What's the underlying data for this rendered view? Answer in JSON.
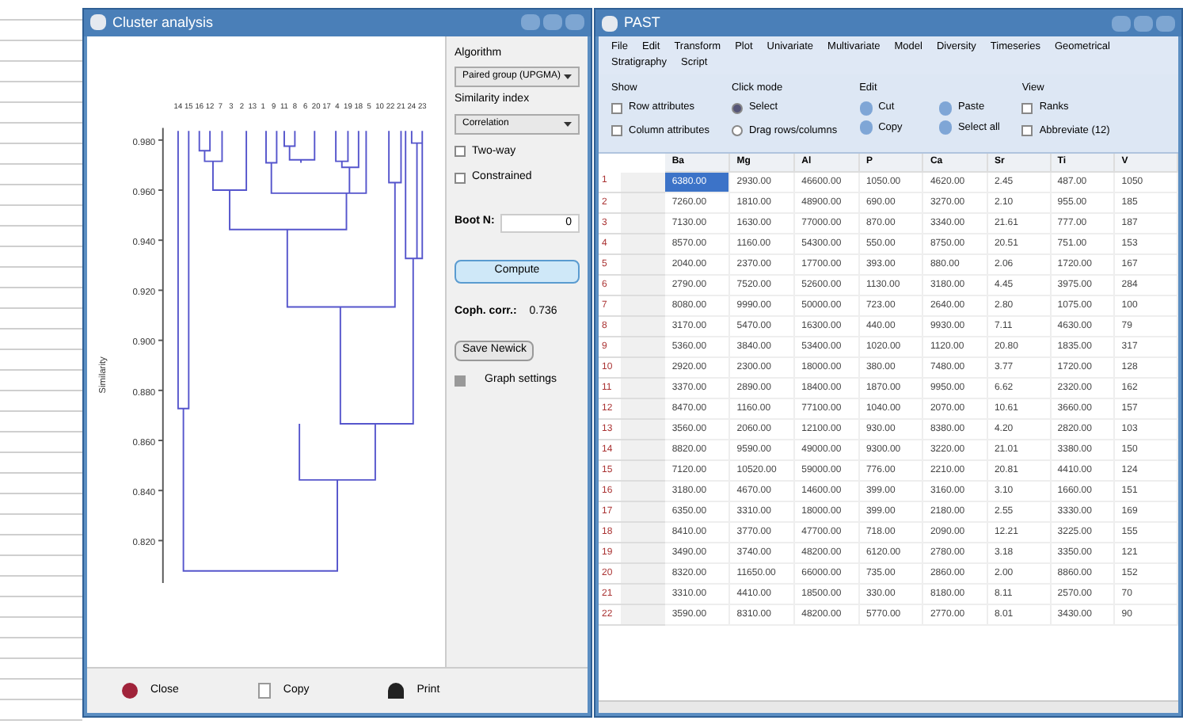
{
  "cluster_window": {
    "title": "Cluster analysis",
    "axis_title": "Similarity",
    "y_ticks": [
      "0.980",
      "0.960",
      "0.940",
      "0.920",
      "0.900",
      "0.880",
      "0.860",
      "0.840",
      "0.820"
    ],
    "leaf_labels": [
      "14",
      "15",
      "16",
      "12",
      "7",
      "3",
      "2",
      "13",
      "1",
      "9",
      "11",
      "8",
      "6",
      "20",
      "17",
      "4",
      "19",
      "18",
      "5",
      "10",
      "22",
      "21",
      "24",
      "23"
    ],
    "algorithm": {
      "label": "Algorithm",
      "value": "Paired group (UPGMA)"
    },
    "similarity": {
      "label": "Similarity index",
      "value": "Correlation"
    },
    "options": [
      {
        "label": "Two-way",
        "checked": false
      },
      {
        "label": "Constrained",
        "checked": false
      }
    ],
    "boot": {
      "label": "Boot N:",
      "value": "0"
    },
    "compute": "Compute",
    "coph": {
      "label": "Coph. corr.:",
      "value": "0.736"
    },
    "save_button": "Save Newick",
    "graph_settings": "Graph settings",
    "bottom_buttons": [
      "Close",
      "Copy",
      "Print"
    ]
  },
  "past_window": {
    "title": "PAST",
    "menu": [
      "File",
      "Edit",
      "Transform",
      "Plot",
      "Univariate",
      "Multivariate",
      "Model",
      "Diversity",
      "Timeseries",
      "Geometrical",
      "Stratigraphy",
      "Script"
    ],
    "groups": [
      {
        "title": "Show",
        "items": [
          {
            "kind": "check",
            "label": "Row attributes",
            "checked": false
          },
          {
            "kind": "check",
            "label": "Column attributes",
            "checked": false
          }
        ]
      },
      {
        "title": "Click mode",
        "items": [
          {
            "kind": "radio",
            "label": "Select",
            "checked": true
          },
          {
            "kind": "radio",
            "label": "Drag rows/columns",
            "checked": false
          }
        ]
      },
      {
        "title": "Edit",
        "items": [
          {
            "kind": "tool",
            "label": "Cut"
          },
          {
            "kind": "tool",
            "label": "Paste"
          },
          {
            "kind": "tool",
            "label": "Copy"
          },
          {
            "kind": "tool",
            "label": "Select all"
          }
        ]
      },
      {
        "title": "View",
        "items": [
          {
            "kind": "check",
            "label": "Ranks",
            "checked": false
          },
          {
            "kind": "check",
            "label": "Abbreviate (12)",
            "checked": false
          }
        ]
      }
    ],
    "columns": [
      "",
      "Ba",
      "Mg",
      "Al",
      "P",
      "Ca",
      "Sr",
      "Ti",
      "V"
    ],
    "rows": [
      [
        "1",
        "6380.00",
        "2930.00",
        "46600.00",
        "1050.00",
        "4620.00",
        "2.45",
        "487.00",
        "1050"
      ],
      [
        "2",
        "7260.00",
        "1810.00",
        "48900.00",
        "690.00",
        "3270.00",
        "2.10",
        "955.00",
        "185"
      ],
      [
        "3",
        "7130.00",
        "1630.00",
        "77000.00",
        "870.00",
        "3340.00",
        "21.61",
        "777.00",
        "187"
      ],
      [
        "4",
        "8570.00",
        "1160.00",
        "54300.00",
        "550.00",
        "8750.00",
        "20.51",
        "751.00",
        "153"
      ],
      [
        "5",
        "2040.00",
        "2370.00",
        "17700.00",
        "393.00",
        "880.00",
        "2.06",
        "1720.00",
        "167"
      ],
      [
        "6",
        "2790.00",
        "7520.00",
        "52600.00",
        "1130.00",
        "3180.00",
        "4.45",
        "3975.00",
        "284"
      ],
      [
        "7",
        "8080.00",
        "9990.00",
        "50000.00",
        "723.00",
        "2640.00",
        "2.80",
        "1075.00",
        "100"
      ],
      [
        "8",
        "3170.00",
        "5470.00",
        "16300.00",
        "440.00",
        "9930.00",
        "7.11",
        "4630.00",
        "79"
      ],
      [
        "9",
        "5360.00",
        "3840.00",
        "53400.00",
        "1020.00",
        "1120.00",
        "20.80",
        "1835.00",
        "317"
      ],
      [
        "10",
        "2920.00",
        "2300.00",
        "18000.00",
        "380.00",
        "7480.00",
        "3.77",
        "1720.00",
        "128"
      ],
      [
        "11",
        "3370.00",
        "2890.00",
        "18400.00",
        "1870.00",
        "9950.00",
        "6.62",
        "2320.00",
        "162"
      ],
      [
        "12",
        "8470.00",
        "1160.00",
        "77100.00",
        "1040.00",
        "2070.00",
        "10.61",
        "3660.00",
        "157"
      ],
      [
        "13",
        "3560.00",
        "2060.00",
        "12100.00",
        "930.00",
        "8380.00",
        "4.20",
        "2820.00",
        "103"
      ],
      [
        "14",
        "8820.00",
        "9590.00",
        "49000.00",
        "9300.00",
        "3220.00",
        "21.01",
        "3380.00",
        "150"
      ],
      [
        "15",
        "7120.00",
        "10520.00",
        "59000.00",
        "776.00",
        "2210.00",
        "20.81",
        "4410.00",
        "124"
      ],
      [
        "16",
        "3180.00",
        "4670.00",
        "14600.00",
        "399.00",
        "3160.00",
        "3.10",
        "1660.00",
        "151"
      ],
      [
        "17",
        "6350.00",
        "3310.00",
        "18000.00",
        "399.00",
        "2180.00",
        "2.55",
        "3330.00",
        "169"
      ],
      [
        "18",
        "8410.00",
        "3770.00",
        "47700.00",
        "718.00",
        "2090.00",
        "12.21",
        "3225.00",
        "155"
      ],
      [
        "19",
        "3490.00",
        "3740.00",
        "48200.00",
        "6120.00",
        "2780.00",
        "3.18",
        "3350.00",
        "121"
      ],
      [
        "20",
        "8320.00",
        "11650.00",
        "66000.00",
        "735.00",
        "2860.00",
        "2.00",
        "8860.00",
        "152"
      ],
      [
        "21",
        "3310.00",
        "4410.00",
        "18500.00",
        "330.00",
        "8180.00",
        "8.11",
        "2570.00",
        "70"
      ],
      [
        "22",
        "3590.00",
        "8310.00",
        "48200.00",
        "5770.00",
        "2770.00",
        "8.01",
        "3430.00",
        "90"
      ]
    ],
    "row_selected": [
      true,
      false,
      false,
      false,
      false,
      false,
      false,
      false,
      false,
      false,
      false,
      false,
      false,
      false,
      false,
      false,
      false,
      false,
      false,
      false,
      false,
      false
    ]
  }
}
